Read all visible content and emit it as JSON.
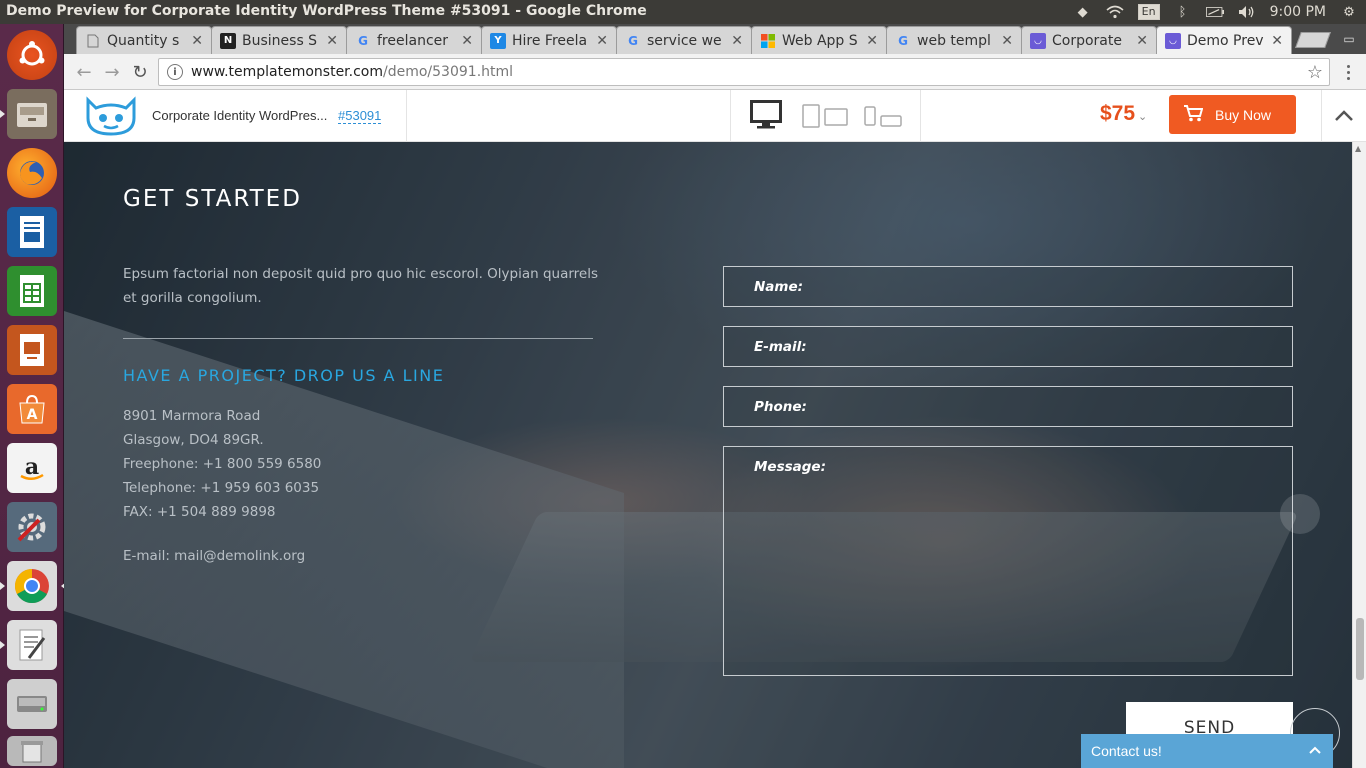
{
  "system": {
    "window_title": "Demo Preview for Corporate Identity WordPress Theme #53091 - Google Chrome",
    "lang": "En",
    "clock": "9:00 PM"
  },
  "tabs": [
    {
      "label": "Quantity s",
      "favicon": "doc"
    },
    {
      "label": "Business S",
      "favicon": "n"
    },
    {
      "label": "freelancer",
      "favicon": "g"
    },
    {
      "label": "Hire Freela",
      "favicon": "y"
    },
    {
      "label": "service we",
      "favicon": "g"
    },
    {
      "label": "Web App S",
      "favicon": "ms"
    },
    {
      "label": "web templ",
      "favicon": "g"
    },
    {
      "label": "Corporate",
      "favicon": "tm"
    },
    {
      "label": "Demo Prev",
      "favicon": "tm",
      "active": true
    }
  ],
  "omnibox": {
    "host": "www.templatemonster.com",
    "path": "/demo/53091.html"
  },
  "tm": {
    "theme_name": "Corporate Identity WordPres...",
    "theme_id": "#53091",
    "price": "$75",
    "buy_label": "Buy Now"
  },
  "section": {
    "title": "GET STARTED",
    "intro": "Epsum factorial non deposit quid pro quo hic escorol. Olypian quarrels et gorilla congolium.",
    "subtitle": "HAVE A PROJECT? DROP US A LINE",
    "address_lines": [
      "8901 Marmora Road",
      "Glasgow, DO4 89GR.",
      "Freephone: +1 800 559 6580",
      "Telephone: +1 959 603 6035",
      "FAX: +1 504 889 9898"
    ],
    "email": "E-mail: mail@demolink.org"
  },
  "form": {
    "name_label": "Name:",
    "email_label": "E-mail:",
    "phone_label": "Phone:",
    "message_label": "Message:",
    "send_label": "SEND"
  },
  "contact_widget": {
    "label": "Contact us!"
  },
  "colors": {
    "accent_blue": "#29a7e0",
    "buy_orange": "#f05a22",
    "price_orange": "#e6501c",
    "launcher_plum": "#5a2a4a",
    "contact_blue": "#5aa5d6"
  }
}
